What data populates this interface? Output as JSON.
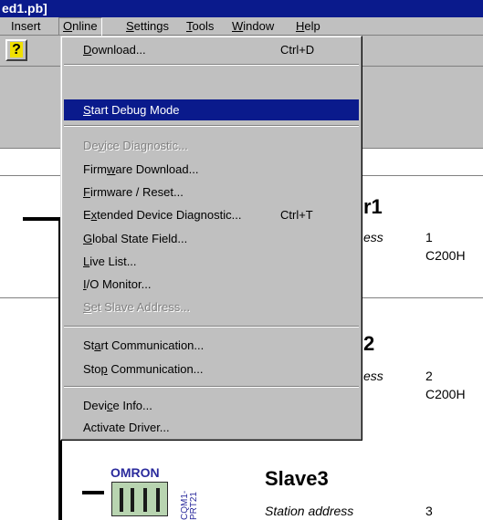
{
  "window": {
    "title_fragment": "ed1.pb]"
  },
  "menubar": {
    "items": [
      {
        "label": "Insert",
        "ul": ""
      },
      {
        "label": "Online",
        "ul": "O"
      },
      {
        "label": "Settings",
        "ul": "S"
      },
      {
        "label": "Tools",
        "ul": "T"
      },
      {
        "label": "Window",
        "ul": "W"
      },
      {
        "label": "Help",
        "ul": "H"
      }
    ]
  },
  "toolbar": {
    "help_glyph": "?"
  },
  "online_menu": {
    "download": {
      "pre": "",
      "ul": "D",
      "post": "ownload...",
      "shortcut": "Ctrl+D"
    },
    "start_debug": {
      "pre": "",
      "ul": "S",
      "post": "tart Debug Mode"
    },
    "device_diagnostic": {
      "pre": "De",
      "ul": "v",
      "post": "ice Diagnostic..."
    },
    "firmware_download": {
      "pre": "Firm",
      "ul": "w",
      "post": "are Download..."
    },
    "firmware_reset": {
      "pre": "",
      "ul": "F",
      "post": "irmware / Reset..."
    },
    "extended_diag": {
      "pre": "E",
      "ul": "x",
      "post": "tended Device Diagnostic...",
      "shortcut": "Ctrl+T"
    },
    "global_state": {
      "pre": "",
      "ul": "G",
      "post": "lobal State Field..."
    },
    "live_list": {
      "pre": "",
      "ul": "L",
      "post": "ive List..."
    },
    "io_monitor": {
      "pre": "",
      "ul": "I",
      "post": "/O Monitor..."
    },
    "set_slave": {
      "pre": "",
      "ul": "S",
      "post": "et Slave Address..."
    },
    "start_comm": {
      "pre": "St",
      "ul": "a",
      "post": "rt Communication..."
    },
    "stop_comm": {
      "pre": "Sto",
      "ul": "p",
      "post": " Communication..."
    },
    "device_info": {
      "pre": "Devi",
      "ul": "c",
      "post": "e Info..."
    },
    "activate_driver": {
      "pre": "Activate Driver...",
      "ul": "",
      "post": ""
    }
  },
  "slaves": [
    {
      "title_fragment": "r1",
      "label_fragment": "ess",
      "station": "1",
      "model_fragment": "C200H"
    },
    {
      "title_fragment": "2",
      "label_fragment": "ess",
      "station": "2",
      "model_fragment": "C200H"
    },
    {
      "title": "Slave3",
      "label": "Station address",
      "station": "3",
      "brand": "OMRON",
      "module": "CQM1-PRT21"
    }
  ]
}
